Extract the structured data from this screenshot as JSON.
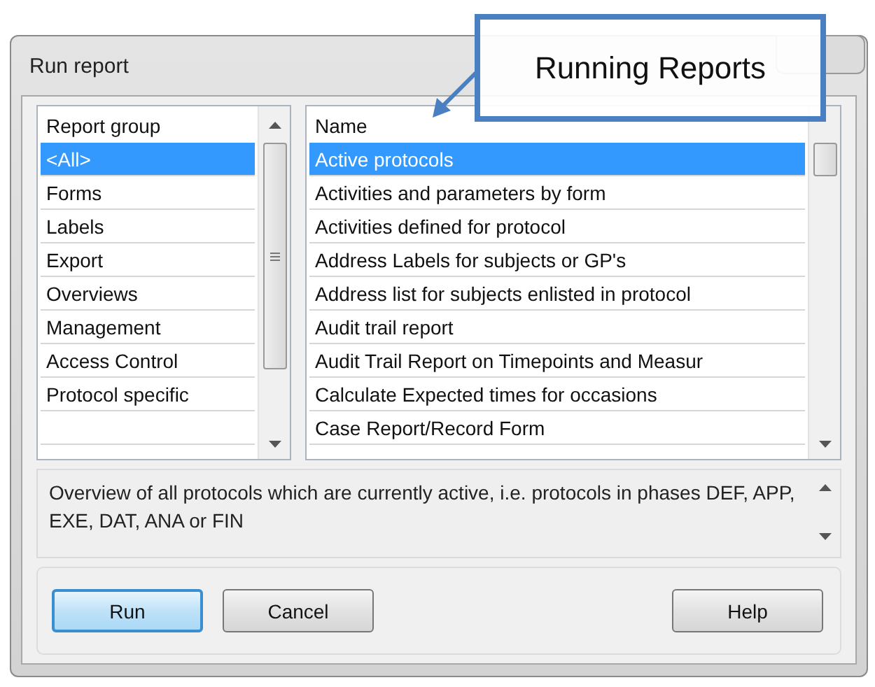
{
  "window": {
    "title": "Run report"
  },
  "callout": {
    "text": "Running Reports"
  },
  "report_groups": {
    "header": "Report group",
    "items": [
      {
        "label": "<All>",
        "selected": true
      },
      {
        "label": "Forms",
        "selected": false
      },
      {
        "label": "Labels",
        "selected": false
      },
      {
        "label": "Export",
        "selected": false
      },
      {
        "label": "Overviews",
        "selected": false
      },
      {
        "label": "Management",
        "selected": false
      },
      {
        "label": "Access Control",
        "selected": false
      },
      {
        "label": "Protocol specific",
        "selected": false
      }
    ]
  },
  "reports": {
    "header": "Name",
    "items": [
      {
        "label": "Active protocols",
        "selected": true
      },
      {
        "label": "Activities and parameters by form",
        "selected": false
      },
      {
        "label": "Activities defined for protocol",
        "selected": false
      },
      {
        "label": "Address Labels for subjects or GP's",
        "selected": false
      },
      {
        "label": "Address list for subjects enlisted in protocol",
        "selected": false
      },
      {
        "label": "Audit trail report",
        "selected": false
      },
      {
        "label": "Audit Trail Report on Timepoints and Measur",
        "selected": false
      },
      {
        "label": "Calculate Expected times for occasions",
        "selected": false
      },
      {
        "label": "Case Report/Record Form",
        "selected": false
      }
    ]
  },
  "description": "Overview of all protocols which are currently active, i.e. protocols in phases DEF, APP, EXE, DAT, ANA or FIN",
  "buttons": [
    {
      "label": "Run",
      "default": true
    },
    {
      "label": "Cancel",
      "default": false
    },
    {
      "label": "Help",
      "default": false
    }
  ]
}
